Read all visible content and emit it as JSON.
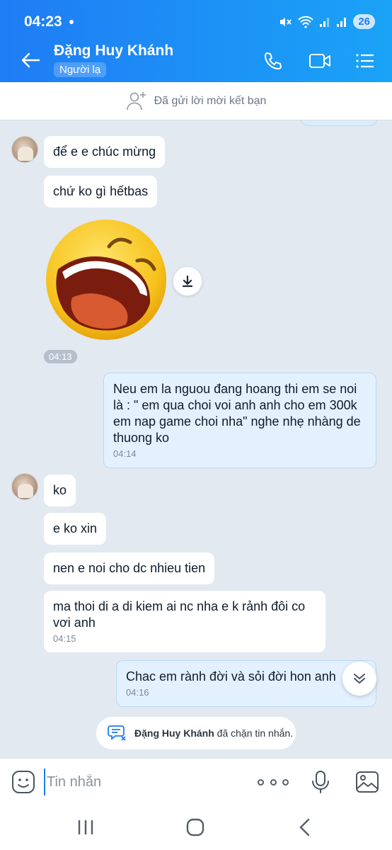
{
  "status_bar": {
    "time": "04:23",
    "battery": "26"
  },
  "header": {
    "contact_name": "Đặng Huy Khánh",
    "badge": "Người lạ",
    "accent_color": "#1f7cf4"
  },
  "friend_bar": {
    "text": "Đã gửi lời mời kết bạn",
    "icon": "add-friend-icon"
  },
  "messages": {
    "m1": {
      "text": "để e e chúc mừng"
    },
    "m2": {
      "text": "chứ ko gì hếtbas"
    },
    "sticker": {
      "timestamp": "04:13",
      "icon": "laughing-face-sticker"
    },
    "m3": {
      "text": "Neu em la nguou đang hoang thi em se noi là : \" em qua choi voi anh anh cho em 300k em nap game choi nha\" nghe nhẹ nhàng de thuong ko",
      "timestamp": "04:14"
    },
    "m4": {
      "text": "ko"
    },
    "m5": {
      "text": "e ko xin"
    },
    "m6": {
      "text": "nen e noi cho dc nhieu tien"
    },
    "m7": {
      "text": "ma thoi di a di kiem ai nc nha e k rảnh đôi co vơi anh",
      "timestamp": "04:15"
    },
    "m8": {
      "text": "Chac em rành đời và sỏi đời hon anh",
      "timestamp": "04:16"
    }
  },
  "blocked_note": {
    "name": "Đặng Huy Khánh",
    "text": " đã chặn tin nhắn."
  },
  "composer": {
    "placeholder": "Tin nhắn"
  }
}
